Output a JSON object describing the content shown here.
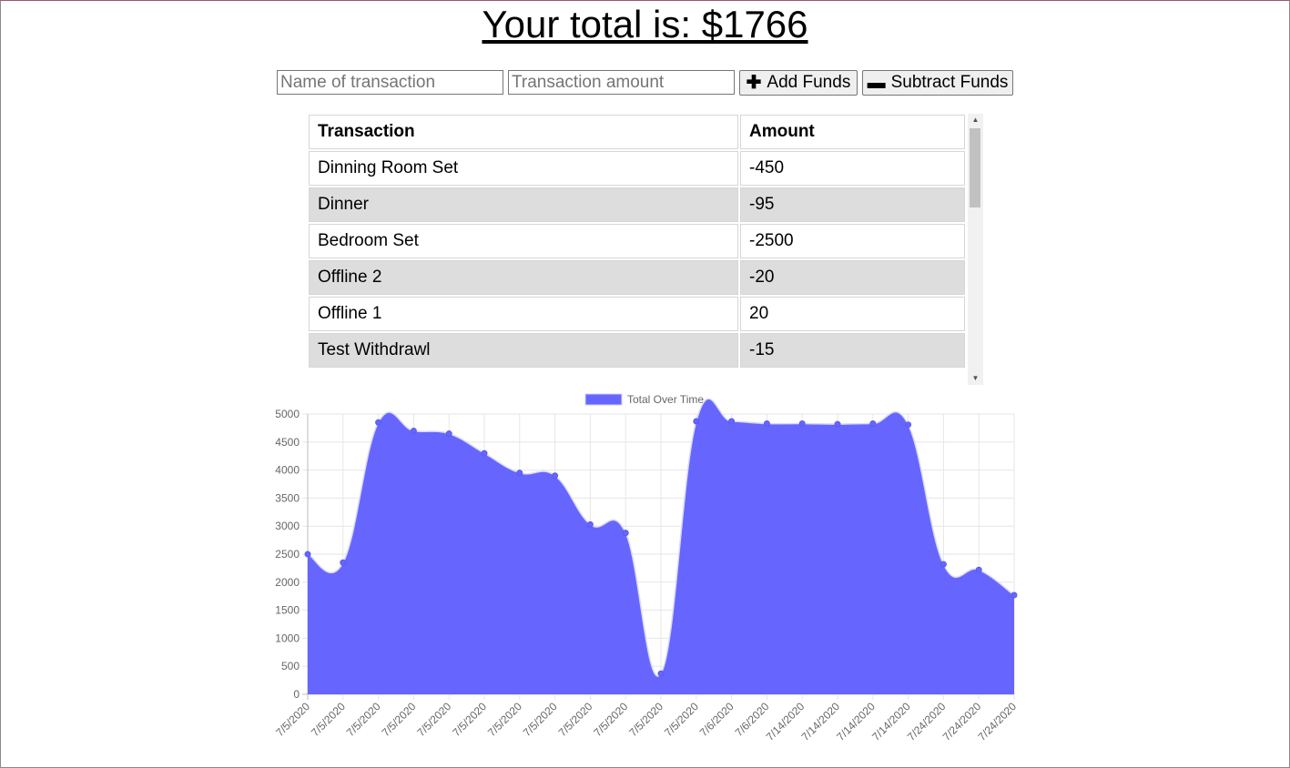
{
  "header": {
    "total_text": "Your total is: $1766"
  },
  "form": {
    "name_placeholder": "Name of transaction",
    "amount_placeholder": "Transaction amount",
    "add_label": "Add Funds",
    "subtract_label": "Subtract Funds",
    "add_icon": "plus-icon",
    "subtract_icon": "minus-icon"
  },
  "table": {
    "headers": [
      "Transaction",
      "Amount"
    ],
    "rows": [
      {
        "name": "Dinning Room Set",
        "amount": "-450"
      },
      {
        "name": "Dinner",
        "amount": "-95"
      },
      {
        "name": "Bedroom Set",
        "amount": "-2500"
      },
      {
        "name": "Offline 2",
        "amount": "-20"
      },
      {
        "name": "Offline 1",
        "amount": "20"
      },
      {
        "name": "Test Withdrawl",
        "amount": "-15"
      }
    ]
  },
  "colors": {
    "chart_fill": "#6666ff",
    "row_alt": "#dddddd"
  },
  "chart_data": {
    "type": "area",
    "legend": "Total Over Time",
    "legend_position": "top",
    "grid": true,
    "ylim": [
      0,
      5000
    ],
    "yticks": [
      0,
      500,
      1000,
      1500,
      2000,
      2500,
      3000,
      3500,
      4000,
      4500,
      5000
    ],
    "x": [
      "7/5/2020",
      "7/5/2020",
      "7/5/2020",
      "7/5/2020",
      "7/5/2020",
      "7/5/2020",
      "7/5/2020",
      "7/5/2020",
      "7/5/2020",
      "7/5/2020",
      "7/5/2020",
      "7/5/2020",
      "7/6/2020",
      "7/6/2020",
      "7/14/2020",
      "7/14/2020",
      "7/14/2020",
      "7/14/2020",
      "7/24/2020",
      "7/24/2020",
      "7/24/2020"
    ],
    "series": [
      {
        "name": "Total Over Time",
        "values": [
          2500,
          2350,
          4850,
          4700,
          4650,
          4300,
          3950,
          3900,
          3030,
          2880,
          370,
          4870,
          4870,
          4830,
          4830,
          4820,
          4830,
          4810,
          2320,
          2220,
          1770
        ]
      }
    ]
  }
}
